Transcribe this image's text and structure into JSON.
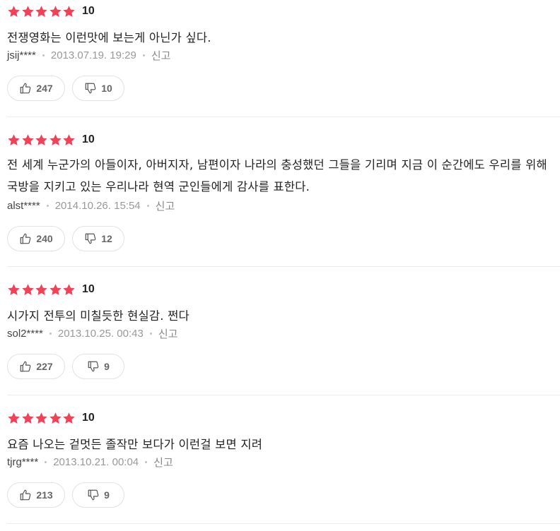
{
  "accent_color": "#f0435a",
  "reviews": [
    {
      "stars": 5,
      "score": "10",
      "comment": "전쟁영화는 이런맛에 보는게 아닌가 싶다.",
      "author": "jsij****",
      "date": "2013.07.19. 19:29",
      "report_label": "신고",
      "likes": "247",
      "dislikes": "10"
    },
    {
      "stars": 5,
      "score": "10",
      "comment": "전 세계 누군가의 아들이자, 아버지자, 남편이자 나라의 충성했던 그들을 기리며 지금 이 순간에도 우리를 위해 국방을 지키고 있는 우리나라 현역 군인들에게 감사를 표한다.",
      "author": "alst****",
      "date": "2014.10.26. 15:54",
      "report_label": "신고",
      "likes": "240",
      "dislikes": "12"
    },
    {
      "stars": 5,
      "score": "10",
      "comment": "시가지 전투의 미칠듯한 현실감. 쩐다",
      "author": "sol2****",
      "date": "2013.10.25. 00:43",
      "report_label": "신고",
      "likes": "227",
      "dislikes": "9"
    },
    {
      "stars": 5,
      "score": "10",
      "comment": "요즘 나오는 겉멋든 졸작만 보다가 이런걸 보면 지려",
      "author": "tjrg****",
      "date": "2013.10.21. 00:04",
      "report_label": "신고",
      "likes": "213",
      "dislikes": "9"
    }
  ]
}
